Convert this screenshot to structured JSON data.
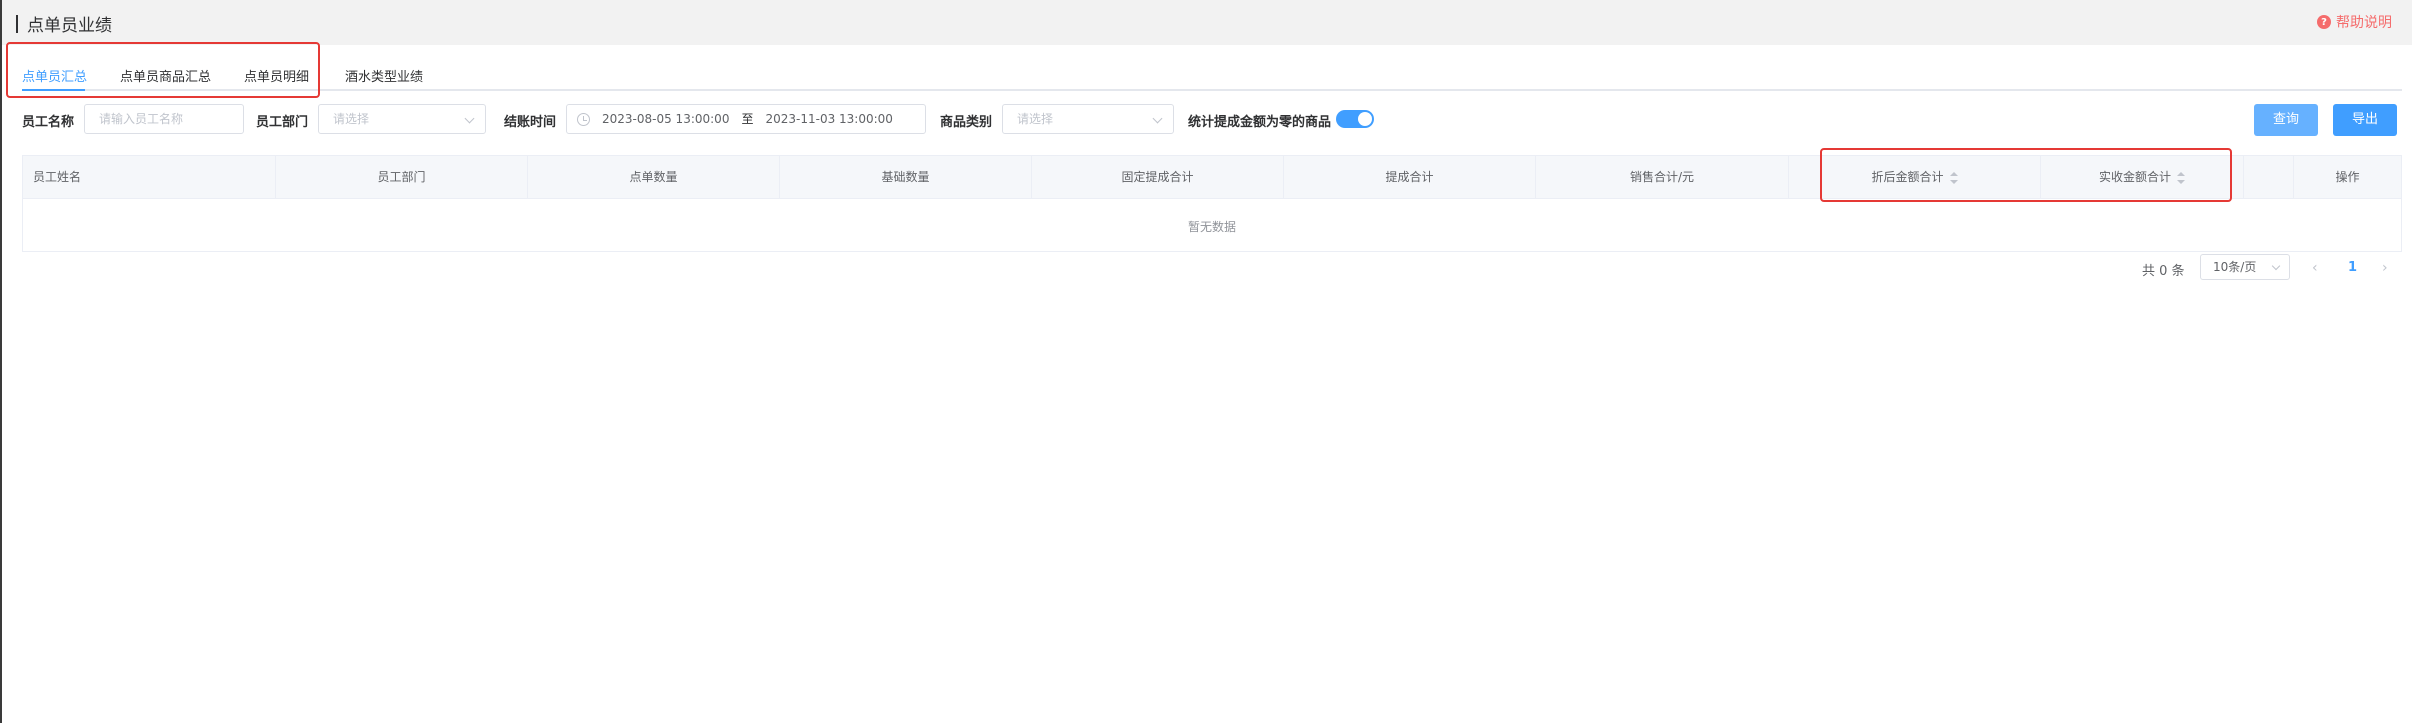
{
  "header": {
    "title": "点单员业绩",
    "help_label": "帮助说明"
  },
  "tabs": [
    {
      "label": "点单员汇总",
      "active": true
    },
    {
      "label": "点单员商品汇总",
      "active": false
    },
    {
      "label": "点单员明细",
      "active": false
    },
    {
      "label": "酒水类型业绩",
      "active": false
    }
  ],
  "filters": {
    "employee_name_label": "员工名称",
    "employee_name_placeholder": "请输入员工名称",
    "department_label": "员工部门",
    "department_placeholder": "请选择",
    "settle_time_label": "结账时间",
    "date_start": "2023-08-05 13:00:00",
    "date_sep": "至",
    "date_end": "2023-11-03 13:00:00",
    "category_label": "商品类别",
    "category_placeholder": "请选择",
    "zero_commission_label": "统计提成金额为零的商品",
    "zero_commission_enabled": true
  },
  "buttons": {
    "query": "查询",
    "export": "导出"
  },
  "table": {
    "columns": [
      "员工姓名",
      "员工部门",
      "点单数量",
      "基础数量",
      "固定提成合计",
      "提成合计",
      "销售合计/元",
      "折后金额合计",
      "实收金额合计",
      "",
      "操作"
    ],
    "empty_text": "暂无数据"
  },
  "pagination": {
    "total": "共 0 条",
    "page_size": "10条/页",
    "current_page": "1"
  },
  "colors": {
    "accent": "#409eff",
    "annotation": "#e53935",
    "help": "#f56c6c"
  }
}
